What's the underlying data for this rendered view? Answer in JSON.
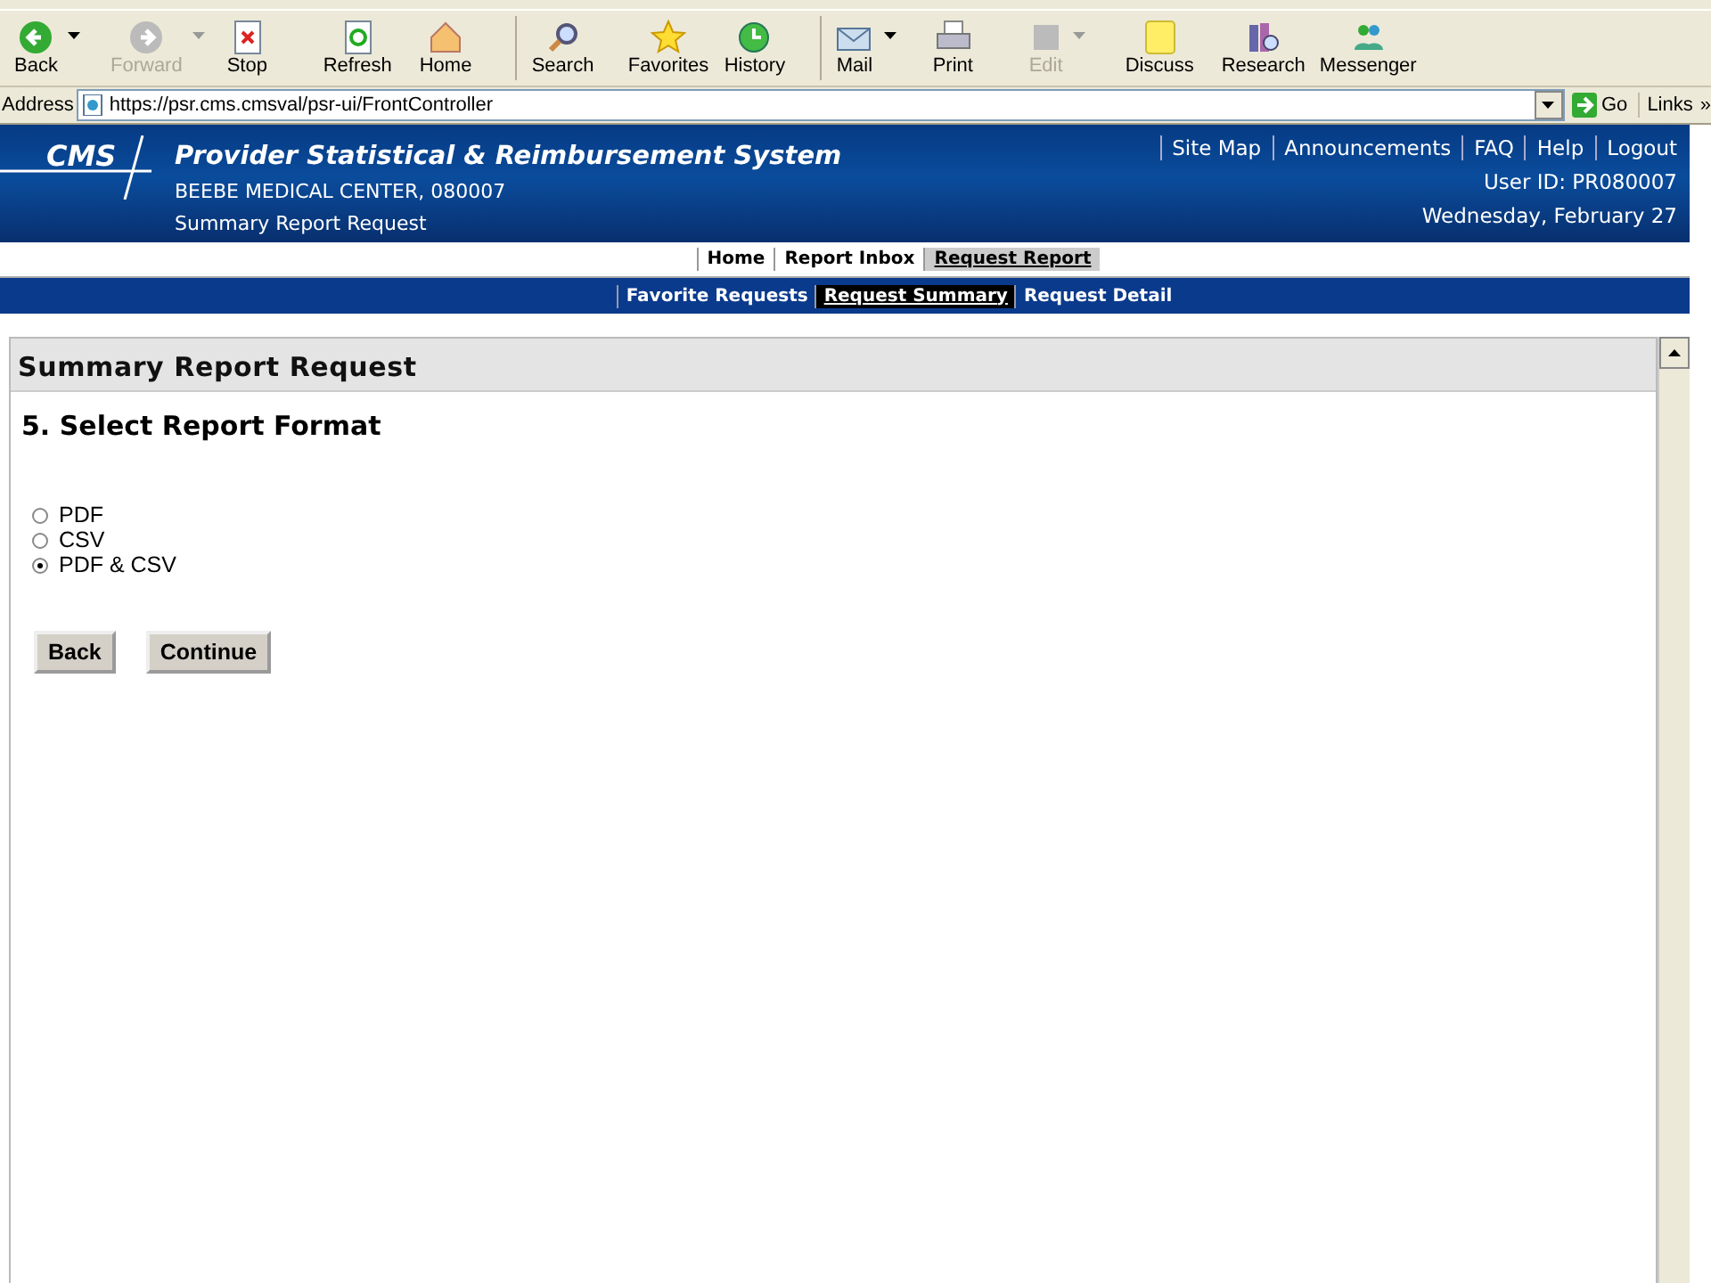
{
  "toolbar": [
    [
      {
        "label": "Back",
        "kind": "back",
        "disabled": false,
        "menu": true
      },
      {
        "label": "Forward",
        "kind": "forward",
        "disabled": true,
        "menu": true
      },
      {
        "label": "Stop",
        "kind": "stop",
        "disabled": false,
        "menu": false
      },
      {
        "label": "Refresh",
        "kind": "refresh",
        "disabled": false,
        "menu": false
      },
      {
        "label": "Home",
        "kind": "home",
        "disabled": false,
        "menu": false
      }
    ],
    [
      {
        "label": "Search",
        "kind": "search",
        "disabled": false,
        "menu": false
      },
      {
        "label": "Favorites",
        "kind": "star",
        "disabled": false,
        "menu": false
      },
      {
        "label": "History",
        "kind": "history",
        "disabled": false,
        "menu": false
      }
    ],
    [
      {
        "label": "Mail",
        "kind": "mail",
        "disabled": false,
        "menu": true
      },
      {
        "label": "Print",
        "kind": "print",
        "disabled": false,
        "menu": false
      },
      {
        "label": "Edit",
        "kind": "edit",
        "disabled": true,
        "menu": true
      },
      {
        "label": "Discuss",
        "kind": "note",
        "disabled": false,
        "menu": false
      },
      {
        "label": "Research",
        "kind": "books",
        "disabled": false,
        "menu": false
      },
      {
        "label": "Messenger",
        "kind": "people",
        "disabled": false,
        "menu": false
      }
    ]
  ],
  "address": {
    "label": "Address",
    "value": "https://psr.cms.cmsval/psr-ui/FrontController",
    "go": "Go",
    "links": "Links",
    "more": "»"
  },
  "header": {
    "logo": "CMS",
    "title": "Provider Statistical & Reimbursement System",
    "provider": "BEEBE MEDICAL CENTER, 080007",
    "page": "Summary Report Request",
    "links": [
      "Site Map",
      "Announcements",
      "FAQ",
      "Help",
      "Logout"
    ],
    "user": "User ID: PR080007",
    "date": "Wednesday, February 27"
  },
  "nav": [
    {
      "label": "Home",
      "selected": false
    },
    {
      "label": "Report Inbox",
      "selected": false
    },
    {
      "label": "Request Report",
      "selected": true
    }
  ],
  "subnav": [
    {
      "label": "Favorite Requests",
      "selected": false
    },
    {
      "label": "Request Summary",
      "selected": true
    },
    {
      "label": "Request Detail",
      "selected": false
    }
  ],
  "panel": {
    "title": "Summary Report Request",
    "step": "5.  Select Report Format",
    "options": [
      {
        "label": "PDF",
        "selected": false
      },
      {
        "label": "CSV",
        "selected": false
      },
      {
        "label": "PDF & CSV",
        "selected": true
      }
    ],
    "buttons": [
      "Back",
      "Continue"
    ]
  }
}
